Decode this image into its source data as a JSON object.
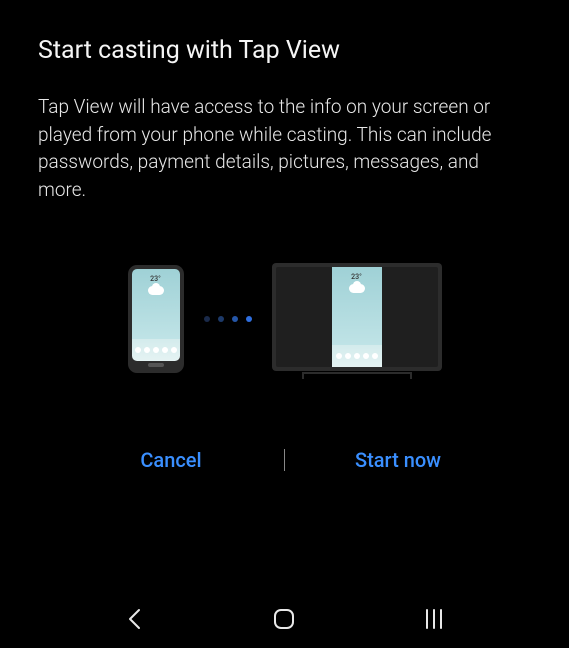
{
  "dialog": {
    "title": "Start casting with Tap View",
    "body": "Tap View will have access to the info on your screen or played from your phone while casting. This can include passwords, payment details, pictures, messages, and more.",
    "illustration": {
      "temperature": "23°"
    },
    "actions": {
      "cancel": "Cancel",
      "confirm": "Start now"
    }
  }
}
